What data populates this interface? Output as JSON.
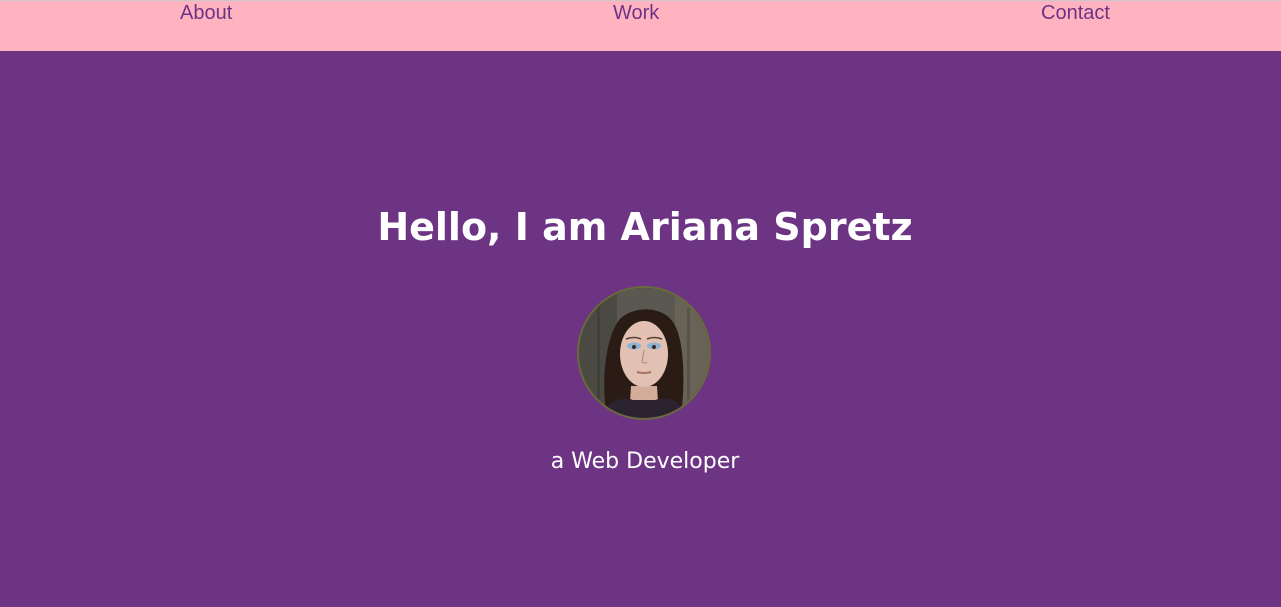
{
  "nav": {
    "items": [
      {
        "label": "About"
      },
      {
        "label": "Work"
      },
      {
        "label": "Contact"
      }
    ]
  },
  "hero": {
    "title": "Hello, I am Ariana Spretz",
    "subtitle": "a Web Developer"
  },
  "colors": {
    "nav_background": "#ffb3c1",
    "nav_link": "#6d3483",
    "page_background": "#6d3483",
    "text": "#ffffff"
  }
}
